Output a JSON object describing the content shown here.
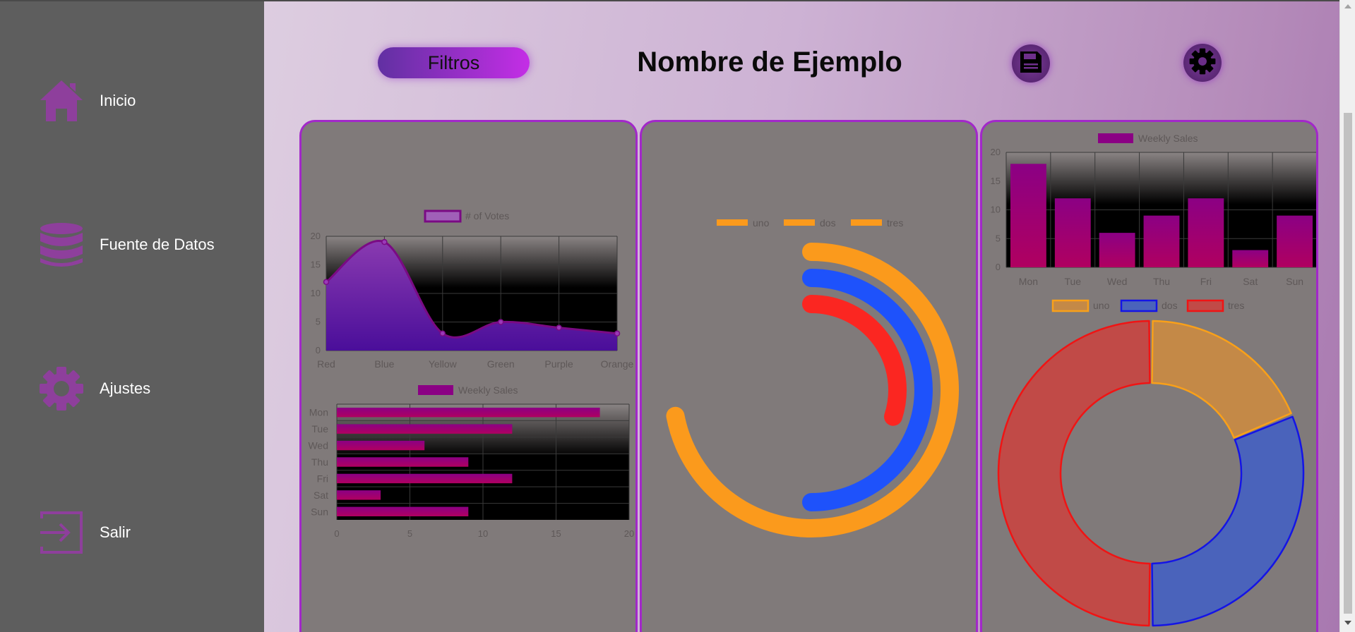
{
  "sidebar": {
    "items": [
      {
        "label": "Inicio",
        "icon": "home-icon"
      },
      {
        "label": "Fuente de Datos",
        "icon": "database-icon"
      },
      {
        "label": "Ajustes",
        "icon": "gear-icon"
      },
      {
        "label": "Salir",
        "icon": "logout-icon"
      }
    ]
  },
  "header": {
    "filter_label": "Filtros",
    "title": "Nombre de Ejemplo",
    "save_icon": "save-icon",
    "settings_icon": "gear-icon"
  },
  "colors": {
    "accent": "#a228c9",
    "sidebar_icon": "#8e3f9c",
    "orange": "#fb9a1c",
    "blue": "#1e52fb",
    "red": "#fb2621",
    "bar": "#8b0084"
  },
  "chart_data": [
    {
      "type": "line",
      "legend": [
        "# of Votes"
      ],
      "categories": [
        "Red",
        "Blue",
        "Yellow",
        "Green",
        "Purple",
        "Orange"
      ],
      "series": [
        {
          "name": "# of Votes",
          "values": [
            12,
            19,
            3,
            5,
            4,
            3
          ]
        }
      ],
      "ylim": [
        0,
        20
      ],
      "yticks": [
        "0",
        "5",
        "10",
        "15",
        "20"
      ],
      "fill": true,
      "grid": true,
      "legend_position": "top"
    },
    {
      "type": "bar",
      "orientation": "horizontal",
      "legend": [
        "Weekly Sales"
      ],
      "categories": [
        "Mon",
        "Tue",
        "Wed",
        "Thu",
        "Fri",
        "Sat",
        "Sun"
      ],
      "series": [
        {
          "name": "Weekly Sales",
          "values": [
            18,
            12,
            6,
            9,
            12,
            3,
            9
          ]
        }
      ],
      "xlim": [
        0,
        20
      ],
      "xticks": [
        "0",
        "5",
        "10",
        "15",
        "20"
      ],
      "grid": true,
      "legend_position": "top"
    },
    {
      "type": "pie",
      "variant": "multi-ring-arc",
      "legend": [
        "uno",
        "dos",
        "tres"
      ],
      "series": [
        {
          "name": "uno",
          "fraction": 0.72
        },
        {
          "name": "dos",
          "fraction": 0.5
        },
        {
          "name": "tres",
          "fraction": 0.3
        }
      ],
      "legend_position": "top"
    },
    {
      "type": "bar",
      "orientation": "vertical",
      "legend": [
        "Weekly Sales"
      ],
      "categories": [
        "Mon",
        "Tue",
        "Wed",
        "Thu",
        "Fri",
        "Sat",
        "Sun"
      ],
      "series": [
        {
          "name": "Weekly Sales",
          "values": [
            18,
            12,
            6,
            9,
            12,
            3,
            9
          ]
        }
      ],
      "ylim": [
        0,
        20
      ],
      "yticks": [
        "0",
        "5",
        "10",
        "15",
        "20"
      ],
      "grid": true,
      "legend_position": "top"
    },
    {
      "type": "pie",
      "variant": "doughnut",
      "legend": [
        "uno",
        "dos",
        "tres"
      ],
      "series": [
        {
          "name": "uno",
          "value": 3
        },
        {
          "name": "dos",
          "value": 5
        },
        {
          "name": "tres",
          "value": 8
        }
      ],
      "legend_position": "top"
    }
  ]
}
